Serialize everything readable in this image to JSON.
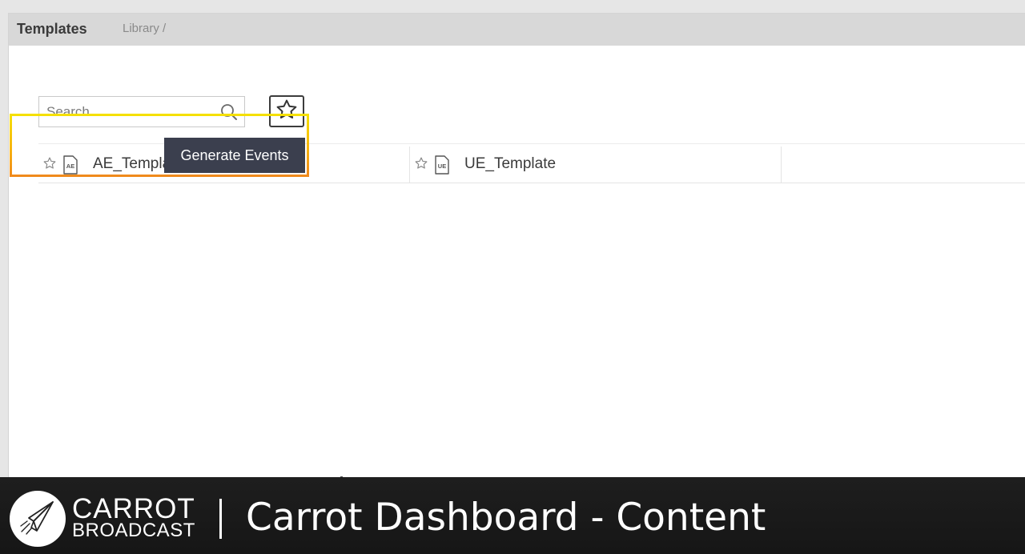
{
  "panel": {
    "title": "Templates",
    "breadcrumb": "Library /"
  },
  "search": {
    "placeholder": "Search",
    "value": "",
    "icon": "search-icon"
  },
  "favorites_filter": {
    "icon": "star-outline-icon"
  },
  "templates": [
    {
      "name": "AE_Template",
      "badge": "AE",
      "favorite": false
    },
    {
      "name": "UE_Template",
      "badge": "UE",
      "favorite": false
    }
  ],
  "tooltip": {
    "text": "Generate Events"
  },
  "highlight": {
    "color_top": "#f5e000",
    "color_bottom": "#f08a1c"
  },
  "footer": {
    "brand_line1": "CARROT",
    "brand_line2": "BROADCAST",
    "title": "Carrot Dashboard - Content",
    "logo_icon": "paper-plane-icon"
  }
}
